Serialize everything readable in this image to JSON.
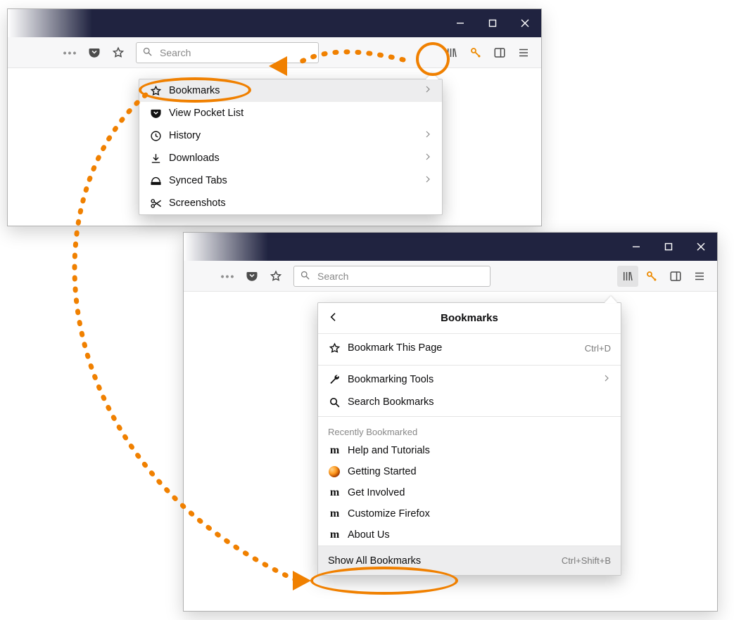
{
  "window1": {
    "search_placeholder": "Search",
    "library_menu": {
      "items": [
        {
          "label": "Bookmarks",
          "icon": "star-outline-icon",
          "chevron": true,
          "hover": true
        },
        {
          "label": "View Pocket List",
          "icon": "pocket-icon",
          "chevron": false,
          "hover": false
        },
        {
          "label": "History",
          "icon": "clock-icon",
          "chevron": true,
          "hover": false
        },
        {
          "label": "Downloads",
          "icon": "download-icon",
          "chevron": true,
          "hover": false
        },
        {
          "label": "Synced Tabs",
          "icon": "synced-tabs-icon",
          "chevron": true,
          "hover": false
        },
        {
          "label": "Screenshots",
          "icon": "scissors-icon",
          "chevron": false,
          "hover": false
        }
      ]
    }
  },
  "window2": {
    "search_placeholder": "Search",
    "bookmarks_menu": {
      "title": "Bookmarks",
      "bookmark_this_page": {
        "label": "Bookmark This Page",
        "shortcut": "Ctrl+D"
      },
      "bookmarking_tools": {
        "label": "Bookmarking Tools"
      },
      "search_bookmarks": {
        "label": "Search Bookmarks"
      },
      "recently_label": "Recently Bookmarked",
      "recent": [
        {
          "label": "Help and Tutorials",
          "icon": "m"
        },
        {
          "label": "Getting Started",
          "icon": "firefox"
        },
        {
          "label": "Get Involved",
          "icon": "m"
        },
        {
          "label": "Customize Firefox",
          "icon": "m"
        },
        {
          "label": "About Us",
          "icon": "m"
        }
      ],
      "show_all": {
        "label": "Show All Bookmarks",
        "shortcut": "Ctrl+Shift+B"
      }
    }
  },
  "annotations": {
    "highlight_color": "#f08000"
  }
}
